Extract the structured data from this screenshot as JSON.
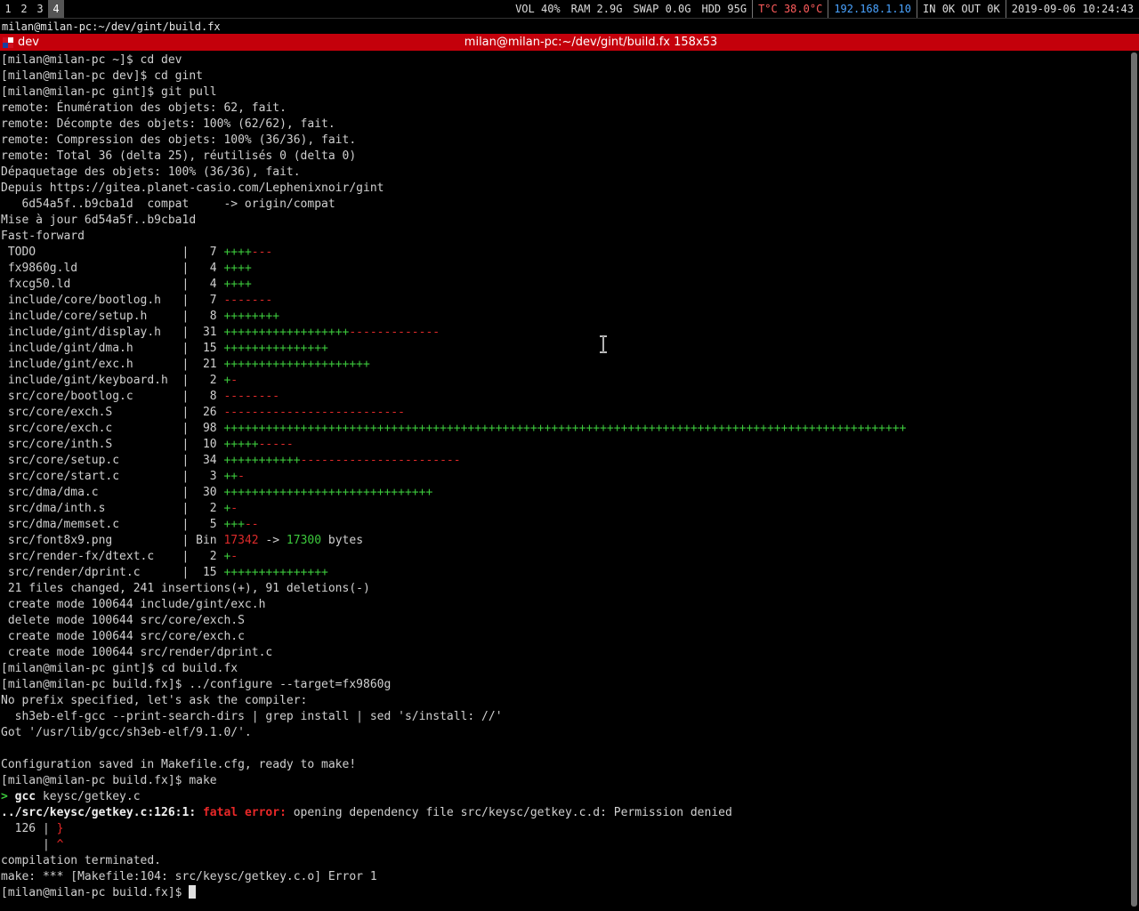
{
  "statusbar": {
    "workspaces": [
      "1",
      "2",
      "3",
      "4"
    ],
    "active_workspace": "4",
    "vol": "VOL 40%",
    "ram": "RAM 2.9G",
    "swap": "SWAP 0.0G",
    "hdd": "HDD 95G",
    "temp": "T°C 38.0°C",
    "ip": "192.168.1.10",
    "net": "IN 0K OUT 0K",
    "datetime": "2019-09-06 10:24:43"
  },
  "window": {
    "title_line": "milan@milan-pc:~/dev/gint/build.fx",
    "tab_name": "dev",
    "tab_title": "milan@milan-pc:~/dev/gint/build.fx 158x53"
  },
  "terminal": {
    "lines": [
      "[milan@milan-pc ~]$ cd dev",
      "[milan@milan-pc dev]$ cd gint",
      "[milan@milan-pc gint]$ git pull",
      "remote: Énumération des objets: 62, fait.",
      "remote: Décompte des objets: 100% (62/62), fait.",
      "remote: Compression des objets: 100% (36/36), fait.",
      "remote: Total 36 (delta 25), réutilisés 0 (delta 0)",
      "Dépaquetage des objets: 100% (36/36), fait.",
      "Depuis https://gitea.planet-casio.com/Lephenixnoir/gint",
      "   6d54a5f..b9cba1d  compat     -> origin/compat",
      "Mise à jour 6d54a5f..b9cba1d",
      "Fast-forward"
    ],
    "diffstat": [
      {
        "file": " TODO                     ",
        "count": "  7",
        "plus": "++++",
        "minus": "---"
      },
      {
        "file": " fx9860g.ld               ",
        "count": "  4",
        "plus": "++++",
        "minus": ""
      },
      {
        "file": " fxcg50.ld                ",
        "count": "  4",
        "plus": "++++",
        "minus": ""
      },
      {
        "file": " include/core/bootlog.h   ",
        "count": "  7",
        "plus": "",
        "minus": "-------"
      },
      {
        "file": " include/core/setup.h     ",
        "count": "  8",
        "plus": "++++++++",
        "minus": ""
      },
      {
        "file": " include/gint/display.h   ",
        "count": " 31",
        "plus": "++++++++++++++++++",
        "minus": "-------------"
      },
      {
        "file": " include/gint/dma.h       ",
        "count": " 15",
        "plus": "+++++++++++++++",
        "minus": ""
      },
      {
        "file": " include/gint/exc.h       ",
        "count": " 21",
        "plus": "+++++++++++++++++++++",
        "minus": ""
      },
      {
        "file": " include/gint/keyboard.h  ",
        "count": "  2",
        "plus": "+",
        "minus": "-"
      },
      {
        "file": " src/core/bootlog.c       ",
        "count": "  8",
        "plus": "",
        "minus": "--------"
      },
      {
        "file": " src/core/exch.S          ",
        "count": " 26",
        "plus": "",
        "minus": "--------------------------"
      },
      {
        "file": " src/core/exch.c          ",
        "count": " 98",
        "plus": "++++++++++++++++++++++++++++++++++++++++++++++++++++++++++++++++++++++++++++++++++++++++++++++++++",
        "minus": ""
      },
      {
        "file": " src/core/inth.S          ",
        "count": " 10",
        "plus": "+++++",
        "minus": "-----"
      },
      {
        "file": " src/core/setup.c         ",
        "count": " 34",
        "plus": "+++++++++++",
        "minus": "-----------------------"
      },
      {
        "file": " src/core/start.c         ",
        "count": "  3",
        "plus": "++",
        "minus": "-"
      },
      {
        "file": " src/dma/dma.c            ",
        "count": " 30",
        "plus": "++++++++++++++++++++++++++++++",
        "minus": ""
      },
      {
        "file": " src/dma/inth.s           ",
        "count": "  2",
        "plus": "+",
        "minus": "-"
      },
      {
        "file": " src/dma/memset.c         ",
        "count": "  5",
        "plus": "+++",
        "minus": "--"
      }
    ],
    "bin_line": {
      "file": " src/font8x9.png          ",
      "prefix": " Bin ",
      "old": "17342",
      "arrow": " -> ",
      "new": "17300",
      "suffix": " bytes"
    },
    "diffstat2": [
      {
        "file": " src/render-fx/dtext.c    ",
        "count": "  2",
        "plus": "+",
        "minus": "-"
      },
      {
        "file": " src/render/dprint.c      ",
        "count": " 15",
        "plus": "+++++++++++++++",
        "minus": ""
      }
    ],
    "lines2": [
      " 21 files changed, 241 insertions(+), 91 deletions(-)",
      " create mode 100644 include/gint/exc.h",
      " delete mode 100644 src/core/exch.S",
      " create mode 100644 src/core/exch.c",
      " create mode 100644 src/render/dprint.c",
      "[milan@milan-pc gint]$ cd build.fx",
      "[milan@milan-pc build.fx]$ ../configure --target=fx9860g",
      "No prefix specified, let's ask the compiler:",
      "  sh3eb-elf-gcc --print-search-dirs | grep install | sed 's/install: //'",
      "Got '/usr/lib/gcc/sh3eb-elf/9.1.0/'.",
      "",
      "Configuration saved in Makefile.cfg, ready to make!",
      "[milan@milan-pc build.fx]$ make"
    ],
    "gcc_line": {
      "marker": "> ",
      "cmd": "gcc",
      "arg": " keysc/getkey.c"
    },
    "error_line": {
      "location": "../src/keysc/getkey.c:126:1:",
      "label": " fatal error:",
      "message": " opening dependency file src/keysc/getkey.c.d: Permission denied"
    },
    "code_line": {
      "prefix": "  126 | ",
      "code": "}"
    },
    "caret_line": {
      "prefix": "      | ",
      "caret": "^"
    },
    "lines3": [
      "compilation terminated.",
      "make: *** [Makefile:104: src/keysc/getkey.c.o] Error 1"
    ],
    "final_prompt": "[milan@milan-pc build.fx]$ "
  }
}
